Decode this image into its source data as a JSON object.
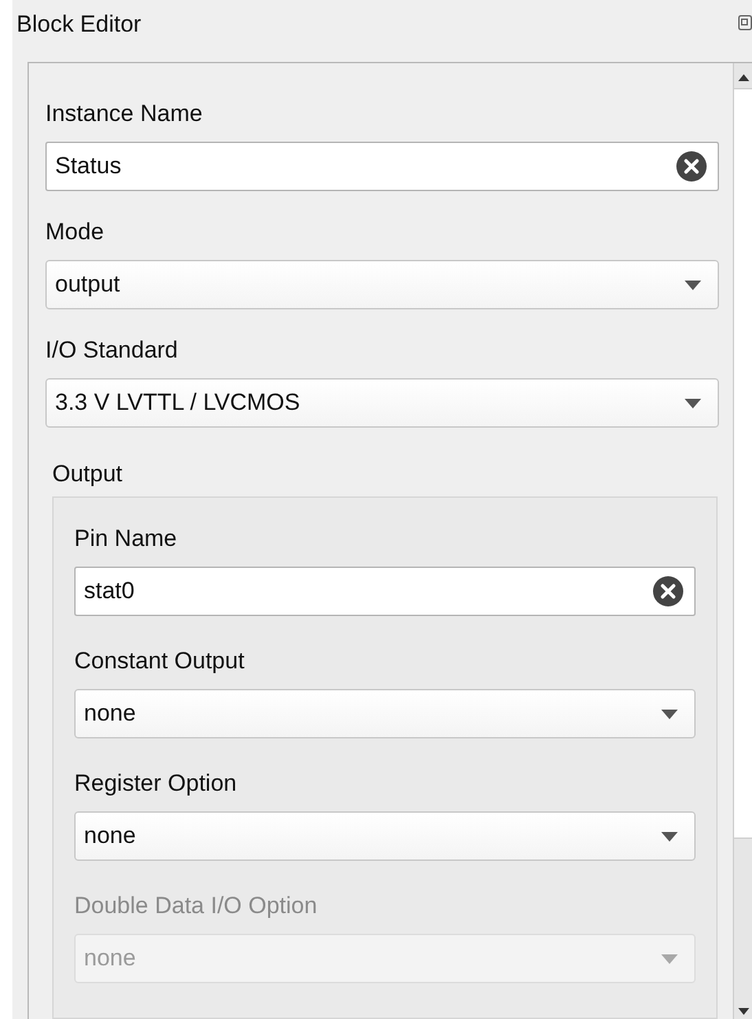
{
  "panel": {
    "title": "Block Editor"
  },
  "fields": [
    {
      "label": "Instance Name",
      "kind": "text",
      "value": "Status",
      "disabled": false
    },
    {
      "label": "Mode",
      "kind": "select",
      "value": "output",
      "disabled": false
    },
    {
      "label": "I/O Standard",
      "kind": "select",
      "value": "3.3 V LVTTL / LVCMOS",
      "disabled": false
    }
  ],
  "output_group": {
    "title": "Output",
    "fields": [
      {
        "label": "Pin Name",
        "kind": "text",
        "value": "stat0",
        "disabled": false
      },
      {
        "label": "Constant Output",
        "kind": "select",
        "value": "none",
        "disabled": false
      },
      {
        "label": "Register Option",
        "kind": "select",
        "value": "none",
        "disabled": false
      },
      {
        "label": "Double Data I/O Option",
        "kind": "select",
        "value": "none",
        "disabled": true
      }
    ]
  }
}
